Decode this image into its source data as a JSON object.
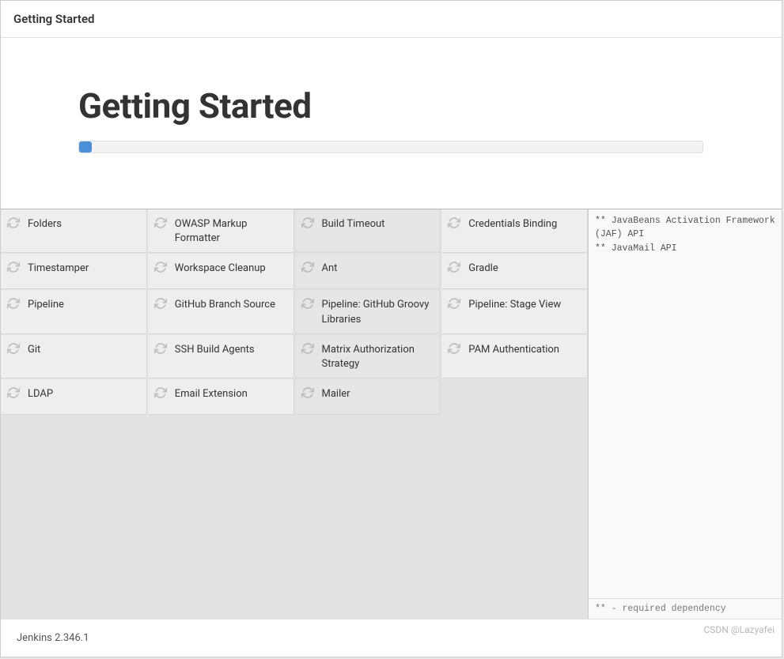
{
  "header": {
    "title": "Getting Started"
  },
  "hero": {
    "heading": "Getting Started"
  },
  "plugins": [
    {
      "name": "Folders",
      "active": false
    },
    {
      "name": "OWASP Markup Formatter",
      "active": false
    },
    {
      "name": "Build Timeout",
      "active": true
    },
    {
      "name": "Credentials Binding",
      "active": false
    },
    {
      "name": "Timestamper",
      "active": false
    },
    {
      "name": "Workspace Cleanup",
      "active": false
    },
    {
      "name": "Ant",
      "active": true
    },
    {
      "name": "Gradle",
      "active": false
    },
    {
      "name": "Pipeline",
      "active": false
    },
    {
      "name": "GitHub Branch Source",
      "active": false
    },
    {
      "name": "Pipeline: GitHub Groovy Libraries",
      "active": true
    },
    {
      "name": "Pipeline: Stage View",
      "active": false
    },
    {
      "name": "Git",
      "active": false
    },
    {
      "name": "SSH Build Agents",
      "active": false
    },
    {
      "name": "Matrix Authorization Strategy",
      "active": true
    },
    {
      "name": "PAM Authentication",
      "active": false
    },
    {
      "name": "LDAP",
      "active": false
    },
    {
      "name": "Email Extension",
      "active": false
    },
    {
      "name": "Mailer",
      "active": true
    }
  ],
  "log": {
    "lines": [
      "** JavaBeans Activation Framework (JAF) API",
      "** JavaMail API"
    ],
    "footer_note": "** - required dependency"
  },
  "footer": {
    "version": "Jenkins 2.346.1"
  },
  "watermark": "CSDN @Lazyafei"
}
